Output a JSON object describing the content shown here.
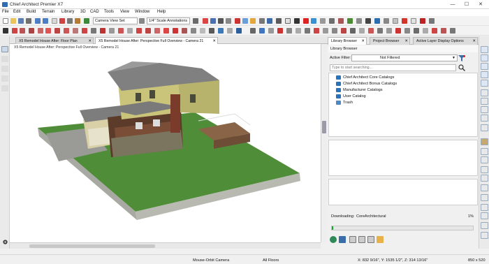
{
  "window": {
    "title": "Chief Architect Premier X7",
    "minimize": "—",
    "maximize": "☐",
    "close": "✕"
  },
  "menu": [
    "File",
    "Edit",
    "Build",
    "Terrain",
    "Library",
    "3D",
    "CAD",
    "Tools",
    "View",
    "Window",
    "Help"
  ],
  "toolbar": {
    "camera_set": "Camera View Set",
    "annotation_set": "1/4\" Scale Annotations"
  },
  "doc_tabs": [
    {
      "label": "X5 Remodel House After: Floor Plan",
      "close": "✕"
    },
    {
      "label": "X5 Remodel House After: Perspective Full Overview - Camera 21",
      "close": "✕"
    }
  ],
  "viewport": {
    "subtitle": "X5 Remodel House After: Perspective Full Overview - Camera 21"
  },
  "panel_tabs": [
    {
      "label": "Library Browser",
      "close": "✕"
    },
    {
      "label": "Project Browser",
      "close": "✕"
    },
    {
      "label": "Active Layer Display Options",
      "close": "✕"
    }
  ],
  "library": {
    "header": "Library Browser",
    "filter_label": "Active Filter:",
    "filter_value": "Not Filtered",
    "search_placeholder": "Type to start searching...",
    "items": [
      {
        "label": "Chief Architect Core Catalogs"
      },
      {
        "label": "Chief Architect Bonus Catalogs"
      },
      {
        "label": "Manufacturer Catalogs"
      },
      {
        "label": "User Catalog"
      },
      {
        "label": "Trash"
      }
    ],
    "downloading_label": "Downloading:",
    "downloading_name": "CoreArchitectural",
    "progress_text": "1%",
    "progress": 0.01
  },
  "status": {
    "mode": "Mouse-Orbit Camera",
    "floor": "All Floors",
    "coords": "X: 832 9/16\", Y: 1535 1/2\", Z: 314 13/16\"",
    "size": "850 x 520"
  },
  "colors": {
    "progress": "#06b025",
    "folder": "#2a73b8",
    "grass": "#4c8a35"
  }
}
